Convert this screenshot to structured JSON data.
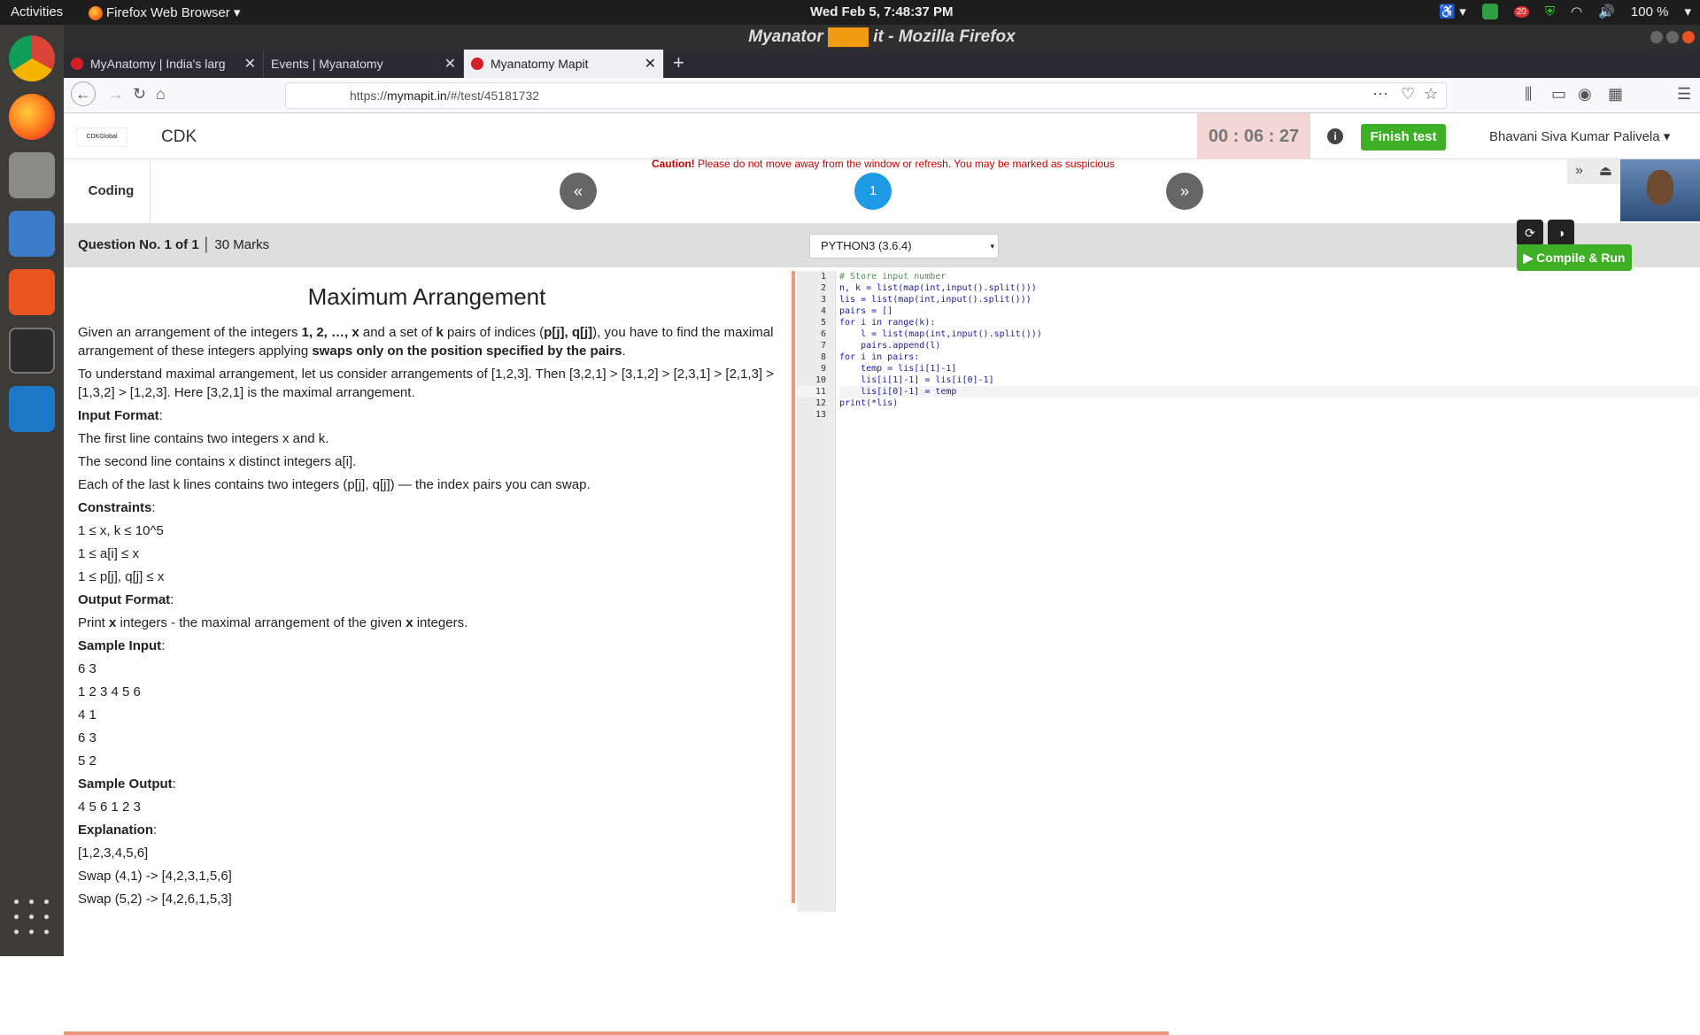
{
  "system": {
    "activities": "Activities",
    "app_name": "Firefox Web Browser",
    "clock": "Wed Feb  5,  7:48:37 PM",
    "battery": "100 %",
    "notif_count": "20"
  },
  "window": {
    "title_left": "Myanator",
    "title_right": "it - Mozilla Firefox"
  },
  "tabs": [
    {
      "label": "MyAnatomy | India's larg"
    },
    {
      "label": "Events | Myanatomy"
    },
    {
      "label": "Myanatomy Mapit"
    }
  ],
  "url": {
    "prefix": "https://",
    "domain": "mymapit.in",
    "path": "/#/test/45181732"
  },
  "app": {
    "logo_text": "CDKGlobal",
    "brand": "CDK",
    "timer": "00 : 06 : 27",
    "finish_label": "Finish test",
    "user": "Bhavani Siva Kumar Palivela",
    "caution_bold": "Caution!",
    "caution_text": " Please do not move away from the window or refresh. You may be marked as suspicious",
    "section": "Coding",
    "prev": "«",
    "page": "1",
    "next": "»",
    "question_no": "Question No. 1 of 1",
    "marks": "30 Marks",
    "language": "PYTHON3 (3.6.4)",
    "run_label": "Compile & Run"
  },
  "problem": {
    "title": "Maximum Arrangement",
    "p1a": "Given an arrangement of the integers ",
    "p1b": "1, 2, …, x",
    "p1c": " and a set of ",
    "p1d": "k",
    "p1e": " pairs of indices (",
    "p1f": "p[j], q[j]",
    "p1g": "), you have to find the maximal arrangement of these integers applying ",
    "p1h": "swaps only on the position specified by the pairs",
    "p1i": ".",
    "p2": "To understand maximal arrangement, let us consider arrangements of [1,2,3]. Then [3,2,1] > [3,1,2] > [2,3,1] > [2,1,3] > [1,3,2] > [1,2,3]. Here [3,2,1] is the maximal arrangement.",
    "input_h": "Input Format",
    "in1": "The first line contains two integers x and k.",
    "in2": "The second line contains x distinct integers a[i].",
    "in3": "Each of the last k lines contains two integers (p[j], q[j]) — the index pairs you can swap.",
    "cons_h": "Constraints",
    "c1": "1 ≤ x, k ≤ 10^5",
    "c2": "1 ≤ a[i] ≤ x",
    "c3": "1 ≤ p[j], q[j] ≤ x",
    "out_h": "Output Format",
    "out_a": "Print ",
    "out_b": "x",
    "out_c": " integers - the maximal arrangement of the given ",
    "out_d": "x",
    "out_e": " integers.",
    "sin_h": "Sample Input",
    "sin": [
      "6 3",
      "1 2 3 4 5 6",
      "4 1",
      "6 3",
      "5 2"
    ],
    "sout_h": "Sample Output",
    "sout": "4 5 6 1 2 3",
    "exp_h": "Explanation",
    "exp": [
      "[1,2,3,4,5,6]",
      "Swap (4,1) -> [4,2,3,1,5,6]",
      "Swap (5,2) -> [4,2,6,1,5,3]"
    ]
  },
  "code": [
    "# Store input number",
    "n, k = list(map(int,input().split()))",
    "lis = list(map(int,input().split()))",
    "pairs = []",
    "for i in range(k):",
    "    l = list(map(int,input().split()))",
    "    pairs.append(l)",
    "for i in pairs:",
    "    temp = lis[i[1]-1]",
    "    lis[i[1]-1] = lis[i[0]-1]",
    "    lis[i[0]-1] = temp",
    "print(*lis)",
    ""
  ],
  "line_numbers": [
    "1",
    "2",
    "3",
    "4",
    "5",
    "6",
    "7",
    "8",
    "9",
    "10",
    "11",
    "12",
    "13"
  ]
}
